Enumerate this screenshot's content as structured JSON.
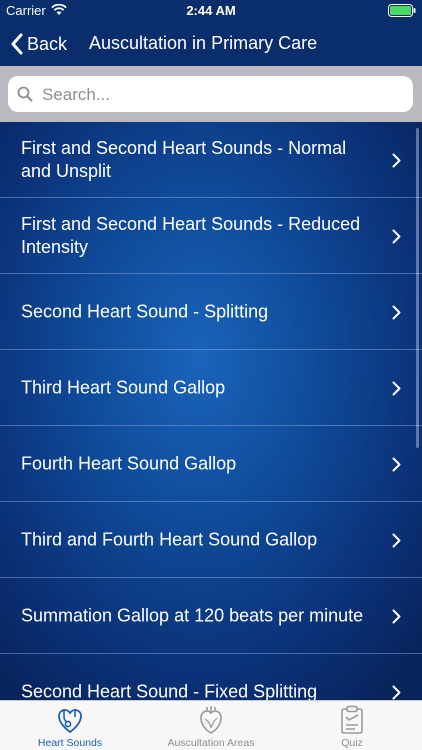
{
  "status_bar": {
    "carrier": "Carrier",
    "time": "2:44 AM"
  },
  "nav": {
    "back_label": "Back",
    "title": "Auscultation in Primary Care"
  },
  "search": {
    "placeholder": "Search..."
  },
  "list_items": [
    {
      "label": "First and Second Heart Sounds - Normal and Unsplit"
    },
    {
      "label": "First and Second Heart Sounds - Reduced Intensity"
    },
    {
      "label": "Second Heart Sound - Splitting"
    },
    {
      "label": "Third Heart Sound Gallop"
    },
    {
      "label": "Fourth Heart Sound Gallop"
    },
    {
      "label": "Third and Fourth Heart Sound Gallop"
    },
    {
      "label": "Summation Gallop at 120 beats per minute"
    },
    {
      "label": "Second Heart Sound - Fixed Splitting"
    }
  ],
  "tabs": [
    {
      "label": "Heart Sounds",
      "icon": "heart-stethoscope-icon",
      "active": true
    },
    {
      "label": "Auscultation Areas",
      "icon": "anatomical-heart-icon",
      "active": false
    },
    {
      "label": "Quiz",
      "icon": "clipboard-icon",
      "active": false
    }
  ],
  "colors": {
    "nav_bar": "#0a2d6b",
    "list_background": "#0f4a98",
    "tab_active": "#1d5fb5",
    "tab_inactive": "#8e8e93",
    "battery": "#4cd964"
  }
}
